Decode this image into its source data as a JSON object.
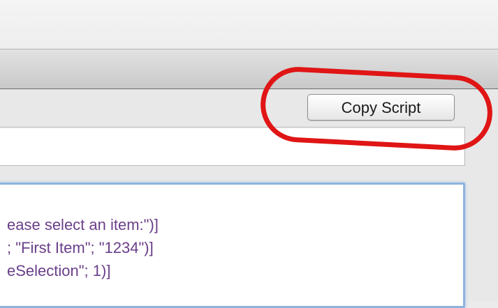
{
  "toolbar": {
    "copy_script_label": "Copy Script"
  },
  "name_field": {
    "value": ""
  },
  "script": {
    "lines": [
      "ease select an item:\")]",
      "; \"First Item\"; \"1234\")]",
      "eSelection\"; 1)]"
    ]
  },
  "colors": {
    "script_text": "#6a3f8a",
    "annotation": "#e01515",
    "focus_ring": "#8fb3de"
  }
}
